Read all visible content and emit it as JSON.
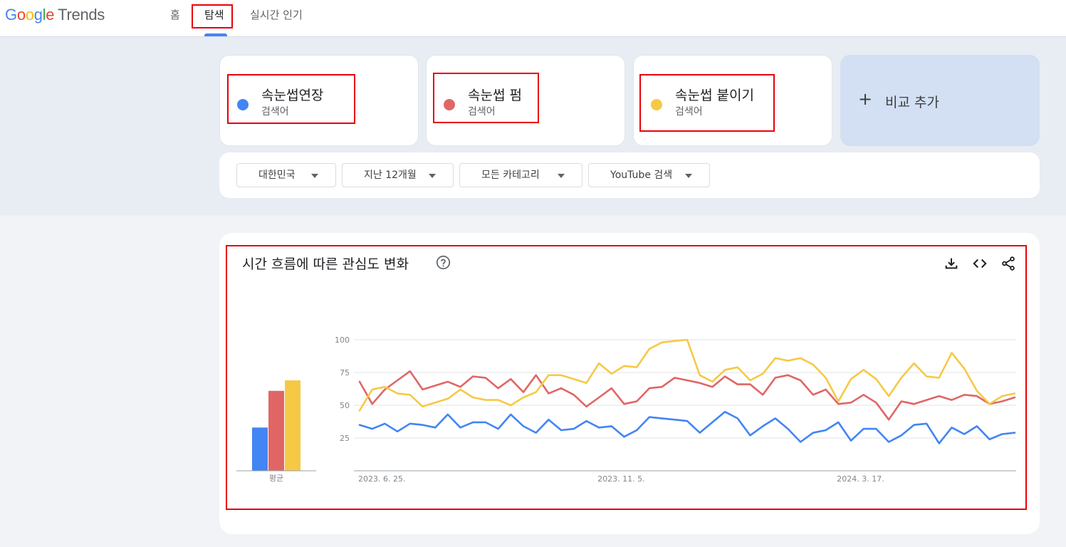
{
  "header": {
    "logo": {
      "google_letters": [
        "G",
        "o",
        "o",
        "g",
        "l",
        "e"
      ],
      "product": "Trends"
    },
    "nav": [
      {
        "label": "홈"
      },
      {
        "label": "탐색"
      },
      {
        "label": "실시간 인기"
      }
    ]
  },
  "terms": [
    {
      "name": "속눈썹연장",
      "type": "검색어",
      "color": "#4285f4"
    },
    {
      "name": "속눈썹 펌",
      "type": "검색어",
      "color": "#e06666"
    },
    {
      "name": "속눈썹 붙이기",
      "type": "검색어",
      "color": "#f6c945"
    }
  ],
  "add_compare": {
    "icon": "plus-icon",
    "label": "비교 추가"
  },
  "filters": [
    {
      "value": "대한민국"
    },
    {
      "value": "지난 12개월"
    },
    {
      "value": "모든 카테고리"
    },
    {
      "value": "YouTube 검색"
    }
  ],
  "interest_panel": {
    "title": "시간 흐름에 따른 관심도 변화",
    "icons": [
      "help-icon",
      "download-icon",
      "embed-code-icon",
      "share-icon"
    ]
  },
  "chart_data": {
    "type": "line",
    "ylim": [
      0,
      100
    ],
    "yticks": [
      25,
      50,
      75,
      100
    ],
    "x_tick_labels": [
      "2023. 6. 25.",
      "2023. 11. 5.",
      "2024. 3. 17."
    ],
    "x_tick_indices": [
      0,
      19,
      38
    ],
    "grid": true,
    "series": [
      {
        "name": "속눈썹연장",
        "color": "#4285f4",
        "values": [
          35,
          32,
          36,
          30,
          36,
          35,
          33,
          43,
          33,
          37,
          37,
          32,
          43,
          34,
          29,
          39,
          31,
          32,
          38,
          33,
          34,
          26,
          31,
          41,
          40,
          39,
          38,
          29,
          37,
          45,
          40,
          27,
          34,
          40,
          32,
          22,
          29,
          31,
          37,
          23,
          32,
          32,
          22,
          27,
          35,
          36,
          21,
          33,
          28,
          34,
          24,
          28,
          29
        ]
      },
      {
        "name": "속눈썹 펌",
        "color": "#e06666",
        "values": [
          68,
          51,
          62,
          69,
          76,
          62,
          65,
          68,
          64,
          72,
          71,
          63,
          70,
          60,
          73,
          59,
          63,
          58,
          49,
          56,
          63,
          51,
          53,
          63,
          64,
          71,
          69,
          67,
          64,
          72,
          66,
          66,
          58,
          71,
          73,
          69,
          58,
          62,
          51,
          52,
          58,
          52,
          39,
          53,
          51,
          54,
          57,
          54,
          58,
          57,
          51,
          53,
          56
        ]
      },
      {
        "name": "속눈썹 붙이기",
        "color": "#f6c945",
        "values": [
          46,
          62,
          64,
          59,
          58,
          49,
          52,
          55,
          62,
          56,
          54,
          54,
          50,
          56,
          60,
          73,
          73,
          70,
          67,
          82,
          74,
          80,
          79,
          93,
          98,
          99,
          100,
          73,
          68,
          77,
          79,
          69,
          74,
          86,
          84,
          86,
          81,
          71,
          53,
          70,
          77,
          70,
          57,
          71,
          82,
          72,
          71,
          90,
          78,
          61,
          51,
          57,
          59
        ]
      }
    ],
    "average": {
      "label": "평균",
      "values": [
        33,
        61,
        69
      ]
    }
  }
}
